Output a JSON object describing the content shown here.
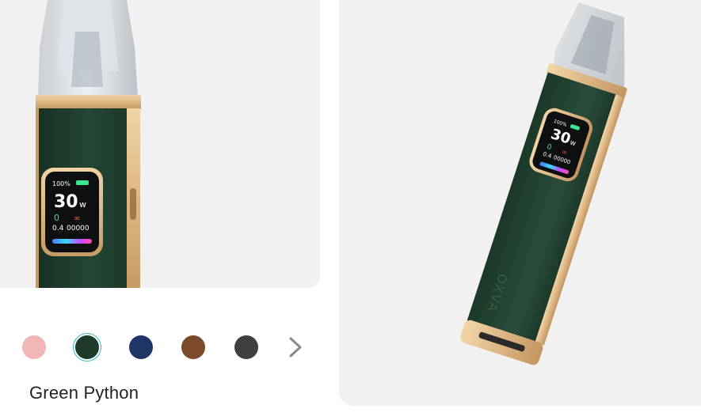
{
  "product": {
    "selected_color_name": "Green Python",
    "screen_left": {
      "battery": "100%",
      "wattage": "30",
      "unit": "w",
      "resistance": "0.4",
      "puffs": "00000",
      "counter_digit": "0"
    },
    "screen_right": {
      "battery": "100%",
      "wattage": "30",
      "unit": "w",
      "resistance": "0.4",
      "puffs": "00000",
      "counter_digit": "0"
    },
    "device_logo": "OXVA"
  },
  "swatches": [
    {
      "name": "pink",
      "color": "#f2b6b6"
    },
    {
      "name": "green-python",
      "color": "#1e3a2a",
      "selected": true
    },
    {
      "name": "navy",
      "color": "#1f3566"
    },
    {
      "name": "brown",
      "color": "#7a4a2a"
    },
    {
      "name": "dark-grey",
      "color": "#3f3f3f"
    }
  ],
  "colors": {
    "body_green": "#1f3b2b",
    "gold": "#d6b17a",
    "panel_bg": "#f1f1f1",
    "selected_ring": "#2fb8c4",
    "arrow": "#8a8a8a"
  }
}
